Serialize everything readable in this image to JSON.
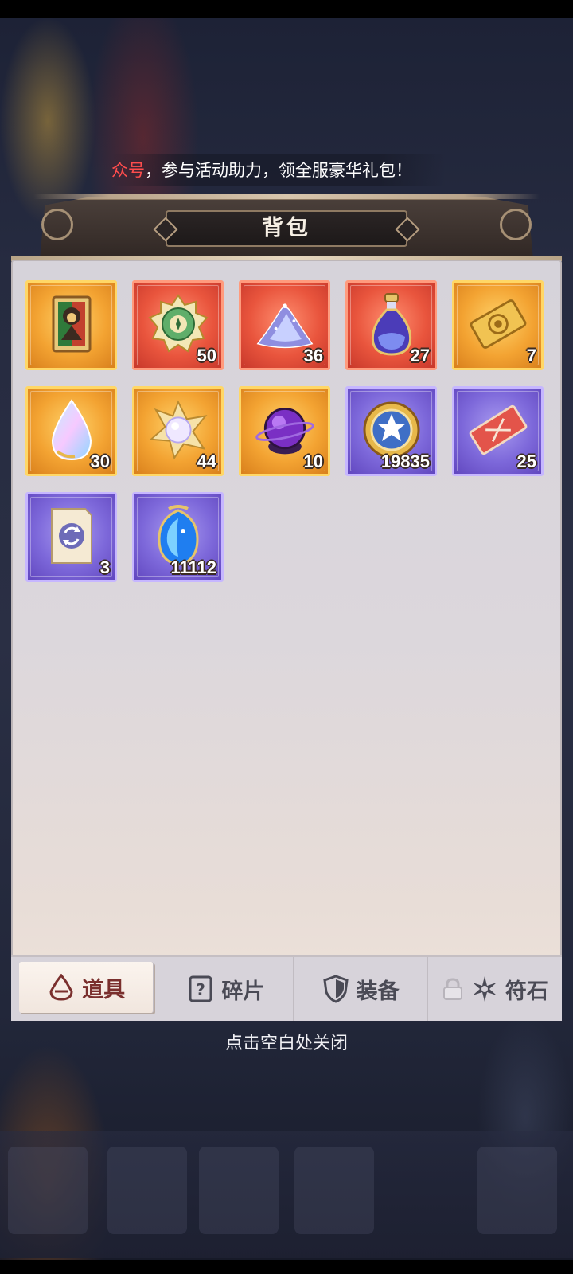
{
  "notice": {
    "highlight": "众号",
    "text": "，参与活动助力，领全服豪华礼包！"
  },
  "panel": {
    "title": "背包"
  },
  "items": [
    {
      "name": "hero-card",
      "rarity": "gold",
      "count": ""
    },
    {
      "name": "emblem-medal",
      "rarity": "red",
      "count": "50"
    },
    {
      "name": "crystal-dust",
      "rarity": "red",
      "count": "36"
    },
    {
      "name": "potion-flask",
      "rarity": "red",
      "count": "27"
    },
    {
      "name": "golden-ticket",
      "rarity": "gold",
      "count": "7"
    },
    {
      "name": "rainbow-drop",
      "rarity": "gold",
      "count": "30"
    },
    {
      "name": "diamond-flower",
      "rarity": "gold",
      "count": "44"
    },
    {
      "name": "purple-orb",
      "rarity": "gold",
      "count": "10"
    },
    {
      "name": "star-coin",
      "rarity": "purple",
      "count": "19835"
    },
    {
      "name": "red-ticket",
      "rarity": "purple",
      "count": "25"
    },
    {
      "name": "refresh-scroll",
      "rarity": "purple",
      "count": "3"
    },
    {
      "name": "blue-gem",
      "rarity": "purple",
      "count": "11112"
    }
  ],
  "tabs": [
    {
      "label": "道具",
      "icon": "item-flask-icon",
      "active": true
    },
    {
      "label": "碎片",
      "icon": "question-card-icon",
      "active": false
    },
    {
      "label": "装备",
      "icon": "shield-icon",
      "active": false
    },
    {
      "label": "符石",
      "icon": "rune-star-icon",
      "locked": true,
      "active": false
    }
  ],
  "close_hint": "点击空白处关闭",
  "colors": {
    "active_tab_text": "#7a2f2d",
    "tab_text": "#4a4a55",
    "count_outline": "#3a2a22"
  }
}
